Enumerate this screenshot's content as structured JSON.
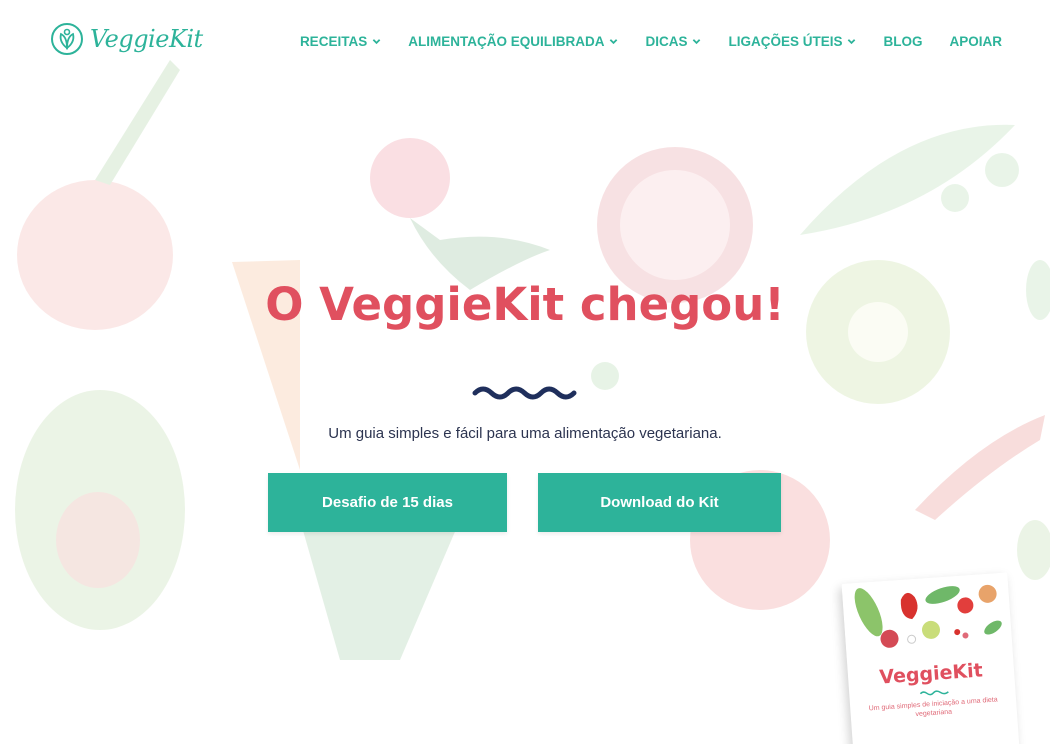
{
  "brand": {
    "name": "VeggieKit",
    "color": "#2db39a"
  },
  "nav": {
    "items": [
      {
        "label": "RECEITAS",
        "has_dropdown": true
      },
      {
        "label": "ALIMENTAÇÃO EQUILIBRADA",
        "has_dropdown": true
      },
      {
        "label": "DICAS",
        "has_dropdown": true
      },
      {
        "label": "LIGAÇÕES ÚTEIS",
        "has_dropdown": true
      },
      {
        "label": "BLOG",
        "has_dropdown": false
      },
      {
        "label": "APOIAR",
        "has_dropdown": false
      }
    ]
  },
  "hero": {
    "title": "O VeggieKit chegou!",
    "subtitle": "Um guia simples e fácil para uma alimentação vegetariana.",
    "title_color": "#e0505f",
    "accent_color": "#1f2f5c"
  },
  "buttons": {
    "challenge_label": "Desafio de 15 dias",
    "download_label": "Download do Kit"
  },
  "book": {
    "title": "VeggieKit",
    "subtitle": "Um guia simples de iniciação a uma dieta vegetariana"
  },
  "icons": {
    "logo": "veggie-plate-icon",
    "dropdown": "chevron-down-icon"
  }
}
